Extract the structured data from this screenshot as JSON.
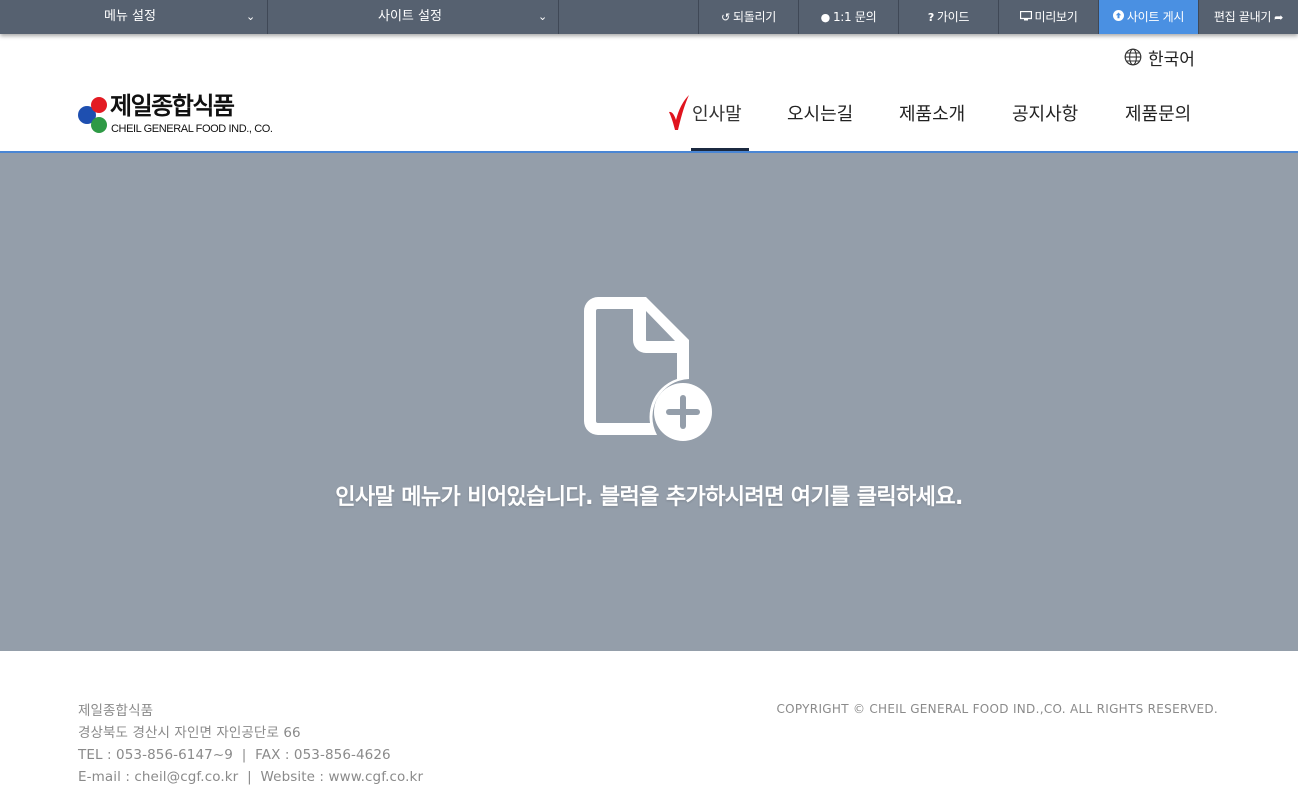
{
  "toolbar": {
    "menu_settings": "메뉴 설정",
    "site_settings": "사이트 설정",
    "undo": "되돌리기",
    "inquiry": "1:1 문의",
    "guide": "가이드",
    "preview": "미리보기",
    "publish": "사이트 게시",
    "finish_edit": "편집 끝내기",
    "accent_color": "#4a90e2",
    "bar_color": "#566170"
  },
  "header": {
    "language": "한국어",
    "logo_kor": "제일종합식품",
    "logo_eng": "CHEIL GENERAL FOOD IND., CO.",
    "nav": [
      {
        "label": "인사말",
        "active": true
      },
      {
        "label": "오시는길"
      },
      {
        "label": "제품소개"
      },
      {
        "label": "공지사항"
      },
      {
        "label": "제품문의"
      }
    ]
  },
  "content": {
    "empty_message": "인사말 메뉴가 비어있습니다. 블럭을 추가하시려면 여기를 클릭하세요.",
    "icon": "file-add-icon",
    "background": "#949eaa"
  },
  "footer": {
    "company": "제일종합식품",
    "address": "경상북도 경산시 자인면 자인공단로 66",
    "contact": "TEL : 053-856-6147~9  |  FAX : 053-856-4626",
    "web": "E-mail : cheil@cgf.co.kr  |  Website : www.cgf.co.kr",
    "copyright": "COPYRIGHT © CHEIL GENERAL FOOD IND.,CO. ALL RIGHTS RESERVED."
  }
}
